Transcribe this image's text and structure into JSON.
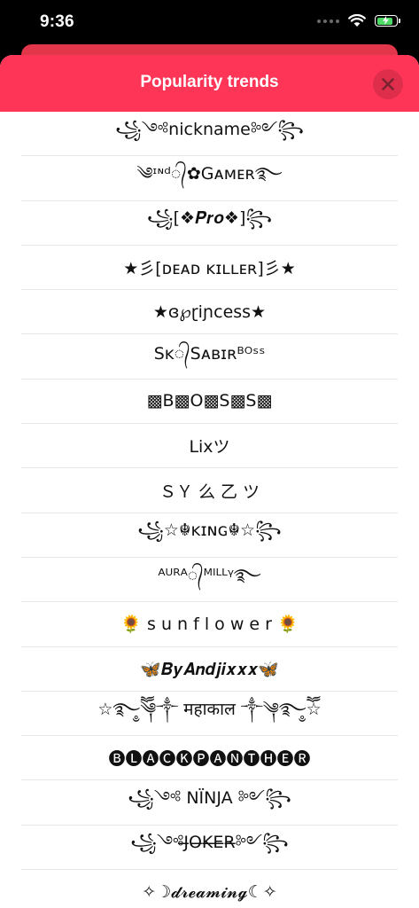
{
  "status_bar": {
    "time": "9:36"
  },
  "sheet": {
    "title": "Popularity trends",
    "close_icon": "close-x-icon"
  },
  "names": [
    "꧁༺nickname༻꧂",
    "༄ᶦᶰᵈ᭄✿Gᴀᴍᴇʀ࿐",
    "꧁[❖𝑷𝒓𝒐❖]꧂",
    "★彡[ᴅᴇᴀᴅ ᴋɪʟʟᴇʀ]彡★",
    "★ɞ℘ɽiɲcess★",
    "Sᴋ᭄Sᴀʙɪʀᴮᴼˢˢ",
    "▩B▩O▩S▩S▩",
    "Lixツ",
    "ＳＹ 么 乙 ツ",
    "꧁☆☬ᴋɪɴɢ☬☆꧂",
    "ᴬᵁᴿᴬ᭄ᴹᴵᴸᴸᵞ࿐",
    "🌻 s u n f l o w e r 🌻",
    "🦋𝑩𝒚𝑨𝒏𝒅𝒋𝒊𝒙𝒙𝒙🦋",
    "☆࿐ཽ༵༆༒ महाकाल ༒༆࿐ཽ༵☆",
    "🅑🅛🅐🅒🅚🅟🅐🅝🅣🅗🅔🅡",
    "꧁༺ NÏNJA ༻꧂",
    "꧁༺J̶O̶K̶E̶R̶༻꧂",
    "✧☽𝓭𝓻𝓮𝓪𝓶𝓲𝓷𝓰☾✧"
  ]
}
